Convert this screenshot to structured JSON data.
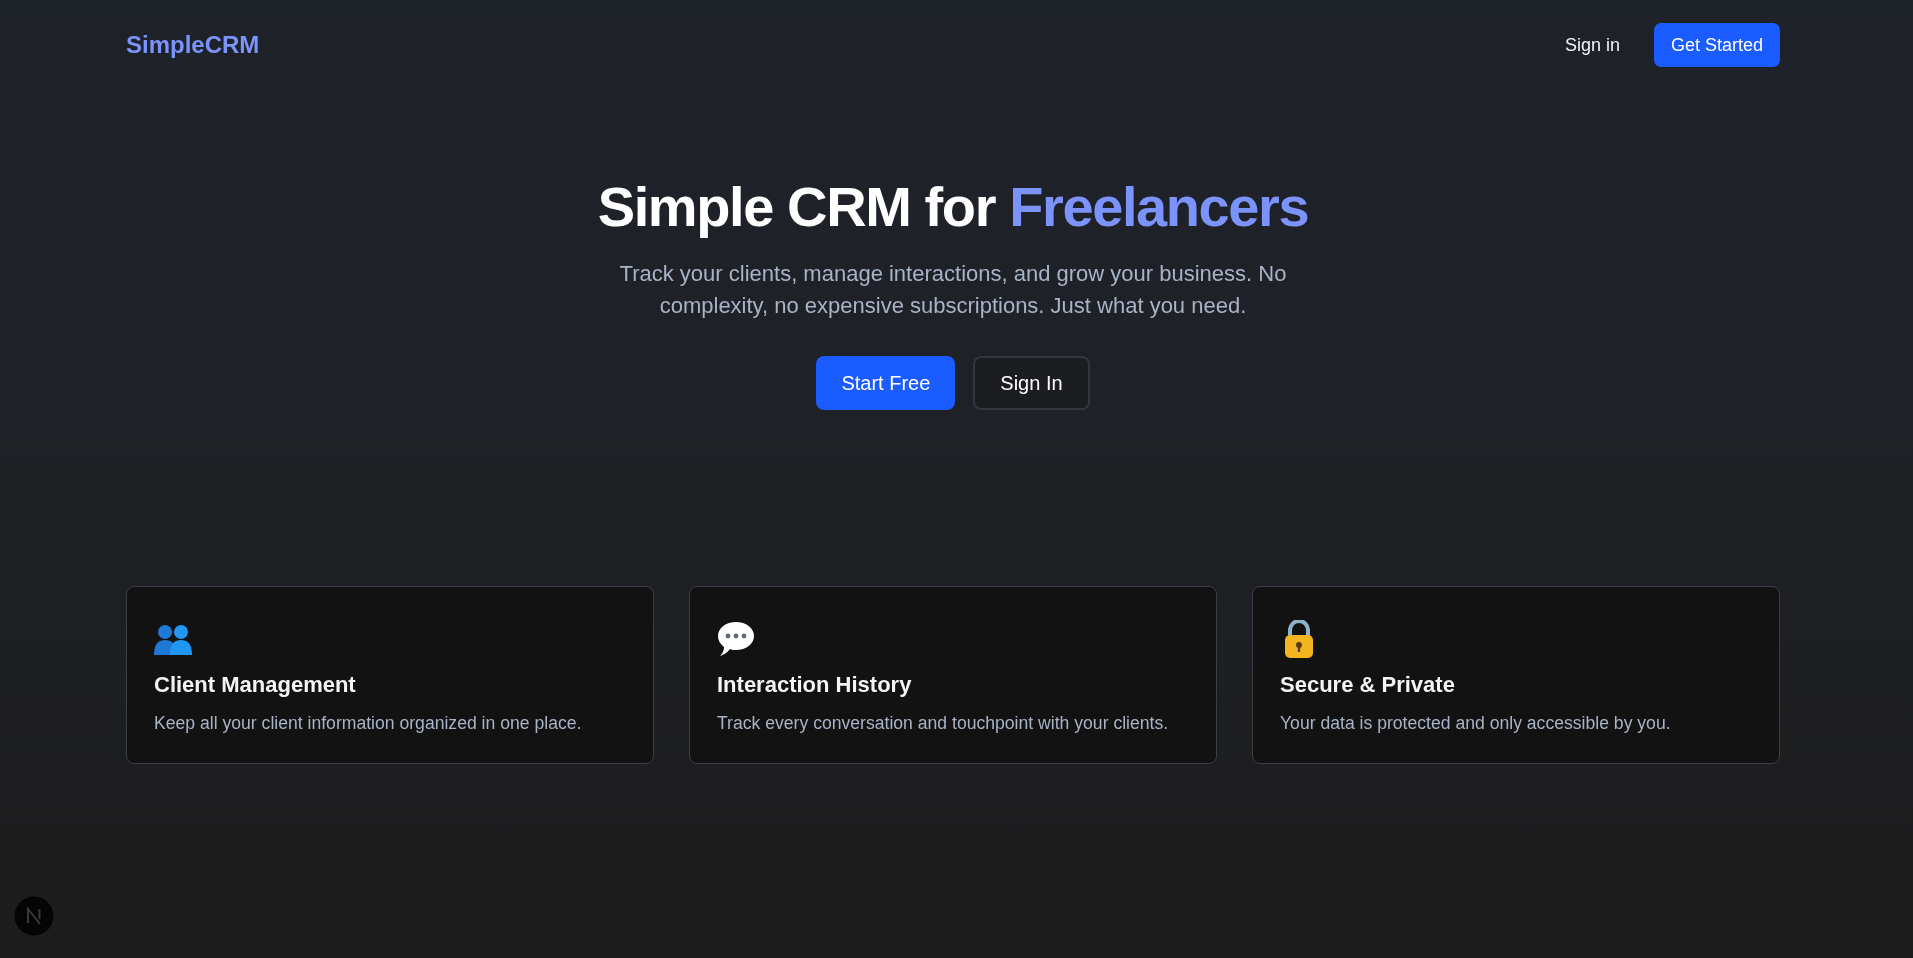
{
  "header": {
    "logo": "SimpleCRM",
    "actions": [
      {
        "label": "Sign in",
        "kind": "link"
      },
      {
        "label": "Get Started",
        "kind": "primary"
      }
    ]
  },
  "hero": {
    "title": {
      "text": "Simple CRM for",
      "highlight": "Freelancers"
    },
    "subtitle": "Track your clients, manage interactions, and grow your business. No complexity, no expensive subscriptions. Just what you need.",
    "buttons": [
      {
        "label": "Start Free",
        "kind": "primary"
      },
      {
        "label": "Sign In",
        "kind": "secondary"
      }
    ]
  },
  "features": [
    {
      "title": "Client Management",
      "description": "Keep all your client information organized in one place."
    },
    {
      "title": "Interaction History",
      "description": "Track every conversation and touchpoint with your clients."
    },
    {
      "title": "Secure & Private",
      "description": "Your data is protected and only accessible by you."
    }
  ]
}
